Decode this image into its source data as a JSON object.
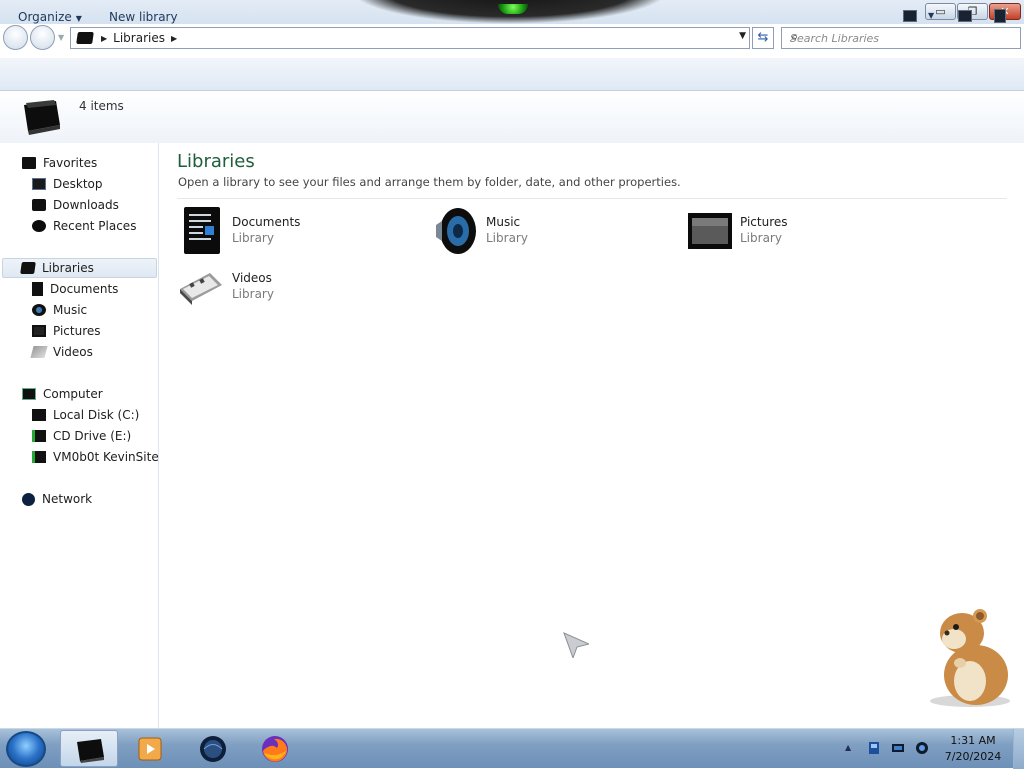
{
  "window": {
    "controls": {
      "minimize": "▭",
      "maximize": "❐",
      "close": "✕"
    }
  },
  "address": {
    "crumb": "Libraries",
    "search_placeholder": "Search Libraries"
  },
  "commandbar": {
    "organize": "Organize",
    "new_library": "New library"
  },
  "details": {
    "item_count": "4 items"
  },
  "navpane": {
    "favorites": "Favorites",
    "favorites_items": [
      "Desktop",
      "Downloads",
      "Recent Places"
    ],
    "libraries": "Libraries",
    "libraries_items": [
      "Documents",
      "Music",
      "Pictures",
      "Videos"
    ],
    "computer": "Computer",
    "computer_items": [
      "Local Disk (C:)",
      "CD Drive (E:)",
      "VM0b0t KevinSite"
    ],
    "network": "Network"
  },
  "content": {
    "title": "Libraries",
    "subtitle": "Open a library to see your files and arrange them by folder, date, and other properties.",
    "tiles": [
      {
        "name": "Documents",
        "type": "Library",
        "icon": "documents-icon"
      },
      {
        "name": "Music",
        "type": "Library",
        "icon": "music-icon"
      },
      {
        "name": "Pictures",
        "type": "Library",
        "icon": "pictures-icon"
      },
      {
        "name": "Videos",
        "type": "Library",
        "icon": "videos-icon"
      }
    ]
  },
  "taskbar": {
    "time": "1:31 AM",
    "date": "7/20/2024",
    "tray_overflow": "▲"
  }
}
